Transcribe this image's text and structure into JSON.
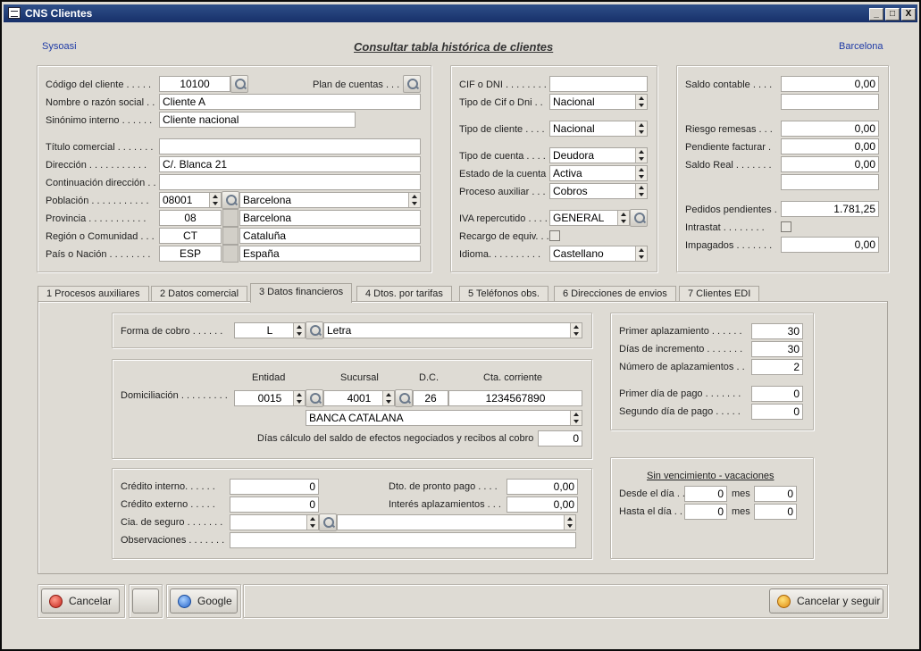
{
  "window": {
    "title": "CNS Clientes",
    "minimize_glyph": "_",
    "maximize_glyph": "□",
    "close_glyph": "X"
  },
  "header": {
    "left": "Sysoasi",
    "title": "Consultar tabla histórica de clientes",
    "right": "Barcelona"
  },
  "client": {
    "codigo_label": "Código del cliente . . . . .",
    "codigo": "10100",
    "plan_label": "Plan de cuentas . . .",
    "nombre_label": "Nombre o razón social . .",
    "nombre": "Cliente A",
    "sinonimo_label": "Sinónimo interno . . . . . .",
    "sinonimo": "Cliente nacional",
    "titulo_label": "Título comercial . . . . . . .",
    "titulo": "",
    "direccion_label": "Dirección . . . . . . . . . . .",
    "direccion": "C/. Blanca 21",
    "continuacion_label": "Continuación dirección . .",
    "continuacion": "",
    "poblacion_label": "Población . . . . . . . . . . .",
    "poblacion_cp": "08001",
    "poblacion": "Barcelona",
    "provincia_label": "Provincia . . . . . . . . . . .",
    "provincia_cod": "08",
    "provincia": "Barcelona",
    "region_label": "Región o Comunidad . . .",
    "region_cod": "CT",
    "region": "Cataluña",
    "pais_label": "País o Nación . . . . . . . .",
    "pais_cod": "ESP",
    "pais": "España"
  },
  "fiscal": {
    "cif_label": "CIF o DNI . . . . . . . .",
    "cif": "",
    "tipo_cif_label": "Tipo de Cif o Dni . .",
    "tipo_cif": "Nacional",
    "tipo_cliente_label": "Tipo de cliente . . . .",
    "tipo_cliente": "Nacional",
    "tipo_cuenta_label": "Tipo de cuenta . . . .",
    "tipo_cuenta": "Deudora",
    "estado_label": "Estado de la cuenta .",
    "estado": "Activa",
    "proceso_label": "Proceso auxiliar . . .",
    "proceso": "Cobros",
    "iva_label": "IVA repercutido . . . .",
    "iva": "GENERAL",
    "recargo_label": "Recargo de equiv. . .",
    "idioma_label": "Idioma. . . . . . . . . .",
    "idioma": "Castellano"
  },
  "saldos": {
    "saldo_contable_label": "Saldo contable . . . .",
    "saldo_contable": "0,00",
    "riesgo_label": "Riesgo remesas . . .",
    "riesgo": "0,00",
    "pendiente_label": "Pendiente facturar .",
    "pendiente": "0,00",
    "saldo_real_label": "Saldo Real . . . . . . .",
    "saldo_real": "0,00",
    "pedidos_label": "Pedidos pendientes .",
    "pedidos": "1.781,25",
    "intrastat_label": "Intrastat . . . . . . . .",
    "impagados_label": "Impagados . . . . . . .",
    "impagados": "0,00"
  },
  "tabs": [
    {
      "label": "1  Procesos auxiliares"
    },
    {
      "label": "2  Datos comercial"
    },
    {
      "label": "3  Datos financieros"
    },
    {
      "label": "4  Dtos. por tarifas"
    },
    {
      "label": "5  Teléfonos obs."
    },
    {
      "label": "6  Direcciones de envios"
    },
    {
      "label": "7  Clientes EDI"
    }
  ],
  "finance": {
    "forma_label": "Forma de cobro . . . . . .",
    "forma_cod": "L",
    "forma": "Letra",
    "entidad_label": "Entidad",
    "sucursal_label": "Sucursal",
    "dc_label": "D.C.",
    "cta_label": "Cta. corriente",
    "domiciliacion_label": "Domiciliación . . . . . . . . .",
    "entidad": "0015",
    "sucursal": "4001",
    "dc": "26",
    "cta": "1234567890",
    "banco": "BANCA CATALANA",
    "dias_label": "Días cálculo del saldo de efectos negociados y recibos al cobro",
    "dias": "0",
    "credito_interno_label": "Crédito interno. . . . . .",
    "credito_interno": "0",
    "credito_externo_label": "Crédito externo . . . . .",
    "credito_externo": "0",
    "cia_label": "Cia. de seguro . . . . . . .",
    "cia_cod": "",
    "cia": "",
    "observaciones_label": "Observaciones . . . . . . .",
    "observaciones": "",
    "dto_label": "Dto. de pronto pago . . . .",
    "dto": "0,00",
    "interes_label": "Interés aplazamientos . . .",
    "interes": "0,00"
  },
  "aplaz": {
    "primer_label": "Primer aplazamiento . . . . . .",
    "primer": "30",
    "dias_inc_label": "Días de incremento . . . . . . .",
    "dias_inc": "30",
    "numero_label": "Número de aplazamientos . .",
    "numero": "2",
    "primer_dia_label": "Primer día de pago . . . . . . .",
    "primer_dia": "0",
    "segundo_dia_label": "Segundo día de pago . . . . .",
    "segundo_dia": "0"
  },
  "vacaciones": {
    "title": "Sin vencimiento - vacaciones",
    "desde_label": "Desde el día . .",
    "desde_dia": "0",
    "mes_label": "mes",
    "desde_mes": "0",
    "hasta_label": "Hasta el día . .",
    "hasta_dia": "0",
    "hasta_mes": "0"
  },
  "buttons": {
    "cancelar": "Cancelar",
    "google": "Google",
    "cancelar_seguir": "Cancelar y seguir"
  },
  "icons": [
    "app-icon",
    "search-icon",
    "spin-icon",
    "cancel-icon",
    "google-icon",
    "cancel-continue-icon"
  ]
}
